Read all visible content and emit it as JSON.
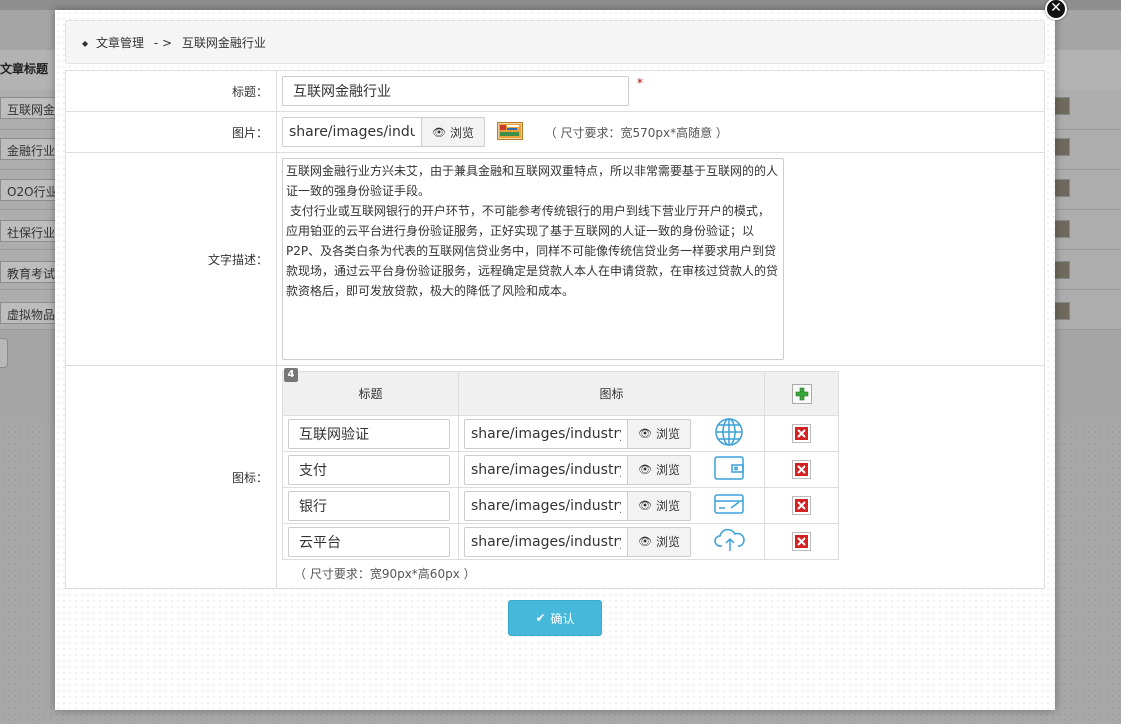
{
  "background": {
    "column_title": "文章标题",
    "rows": [
      "互联网金",
      "金融行业",
      "O2O行业",
      "社保行业",
      "教育考试",
      "虚拟物品"
    ]
  },
  "breadcrumb": {
    "root": "文章管理",
    "separator": "- >",
    "current": "互联网金融行业"
  },
  "form": {
    "title_label": "标题：",
    "title_value": "互联网金融行业",
    "required_mark": "*",
    "image_label": "图片：",
    "image_path": "share/images/indust",
    "browse_label": "浏览",
    "image_hint": "（ 尺寸要求：宽570px*高随意 ）",
    "desc_label": "文字描述：",
    "desc_value": "互联网金融行业方兴未艾，由于兼具金融和互联网双重特点，所以非常需要基于互联网的的人证一致的强身份验证手段。\n 支付行业或互联网银行的开户环节，不可能参考传统银行的用户到线下营业厅开户的模式，应用铂亚的云平台进行身份验证服务，正好实现了基于互联网的人证一致的身份验证；以P2P、及各类白条为代表的互联网信贷业务中，同样不可能像传统信贷业务一样要求用户到贷款现场，通过云平台身份验证服务，远程确定是贷款人本人在申请贷款，在审核过贷款人的贷款资格后，即可发放贷款，极大的降低了风险和成本。",
    "icons_label": "图标：",
    "icons_count": "4",
    "icons_header_title": "标题",
    "icons_header_icon": "图标",
    "icons": [
      {
        "title": "互联网验证",
        "path": "share/images/industry/p",
        "browse": "浏览",
        "icon": "globe-icon"
      },
      {
        "title": "支付",
        "path": "share/images/industry/p",
        "browse": "浏览",
        "icon": "wallet-icon"
      },
      {
        "title": "银行",
        "path": "share/images/industry/p",
        "browse": "浏览",
        "icon": "card-icon"
      },
      {
        "title": "云平台",
        "path": "share/images/industry/p",
        "browse": "浏览",
        "icon": "cloud-upload-icon"
      }
    ],
    "icons_hint": "（ 尺寸要求：宽90px*高60px ）",
    "confirm_label": "确认"
  },
  "colors": {
    "accent": "#46b8da",
    "icon_blue": "#3aa0d8",
    "delete_red": "#d42121",
    "add_green": "#3aa83a"
  }
}
